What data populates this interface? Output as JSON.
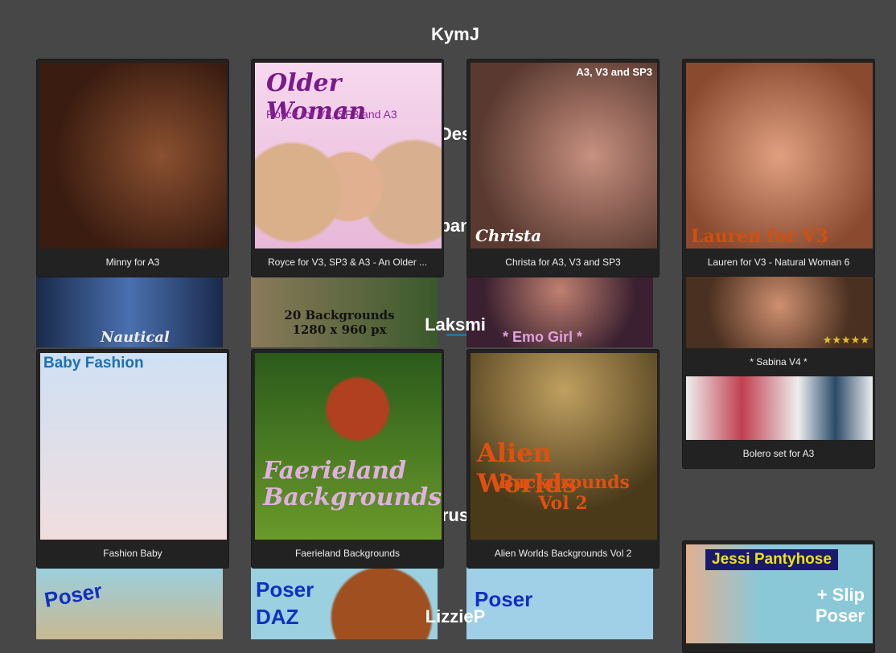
{
  "names": [
    "KymJ",
    "Des",
    "pan",
    "Laksmi",
    "rus",
    "LizzieP"
  ],
  "cards": [
    {
      "caption": "Minny for A3",
      "image_text": ""
    },
    {
      "caption": "Royce for V3, SP3 & A3 - An Older ...",
      "image_text": "Older Woman",
      "image_sub": "Royce for V3, SP3 and A3"
    },
    {
      "caption": "Christa for A3, V3 and SP3",
      "image_text": "Christa",
      "image_sub": "A3, V3 and SP3"
    },
    {
      "caption": "Lauren for V3 - Natural Woman 6",
      "image_text": "Lauren for V3"
    },
    {
      "caption": "Fashion Baby",
      "image_text": "Baby Fashion"
    },
    {
      "caption": "Faerieland Backgrounds",
      "image_text": "Faerieland Backgrounds"
    },
    {
      "caption": "Alien Worlds Backgrounds Vol 2",
      "image_text": "Alien Worlds",
      "image_sub": "Backgrounds Vol 2"
    },
    {
      "caption": "* Sabina V4 *",
      "image_text": "★★★★★"
    },
    {
      "caption": "Bolero set for A3",
      "image_text": ""
    }
  ],
  "strips": [
    {
      "text": "Nautical"
    },
    {
      "text": "20 Backgrounds 1280 x 960 px"
    },
    {
      "text": "* Emo Girl *"
    },
    {
      "text": "Poser"
    },
    {
      "text": "Poser DAZ"
    },
    {
      "text": "Poser"
    },
    {
      "text": "Jessi Pantyhose",
      "sub": "+ Slip Poser"
    }
  ]
}
